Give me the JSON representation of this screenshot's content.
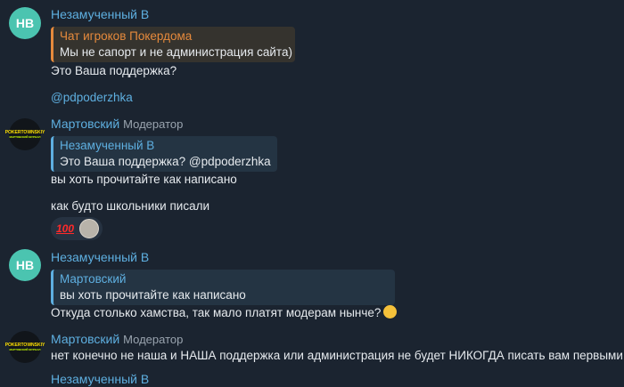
{
  "messages": [
    {
      "avatar": "НВ",
      "sender": "Незамученный В",
      "reply": {
        "name": "Чат игроков Покердома",
        "text": "Мы не сапорт и не администрация сайта)"
      },
      "lines": [
        "Это Ваша поддержка?",
        "@pdpoderzhka"
      ]
    },
    {
      "avatar_text": [
        "POKERTOWNSKIY",
        "МАРТОВСКИЙ ЖУРНАЛ"
      ],
      "sender": "Мартовский",
      "role": "Модератор",
      "reply": {
        "name": "Незамученный В",
        "text": "Это Ваша поддержка?   @pdpoderzhka"
      },
      "lines": [
        "вы хоть прочитайте как написано",
        "как будто школьники писали"
      ],
      "reactions": [
        "100"
      ]
    },
    {
      "avatar": "НВ",
      "sender": "Незамученный В",
      "reply": {
        "name": "Мартовский",
        "text": "вы хоть прочитайте как написано"
      },
      "lines": [
        "Откуда столько хамства, так мало платят модерам нынче?"
      ],
      "emoji": "laughing-tears-emoji"
    },
    {
      "sender": "Мартовский",
      "role": "Модератор",
      "lines": [
        "нет конечно не наша и НАША поддержка или администрация  не будет НИКОГДА писать вам первыми"
      ]
    },
    {
      "sender": "Незамученный В"
    }
  ],
  "colors": {
    "background": "#1b2430",
    "name": "#5eafe0",
    "reply_orange": "#e68a3c",
    "avatar_nv": "#4bc4b0"
  }
}
